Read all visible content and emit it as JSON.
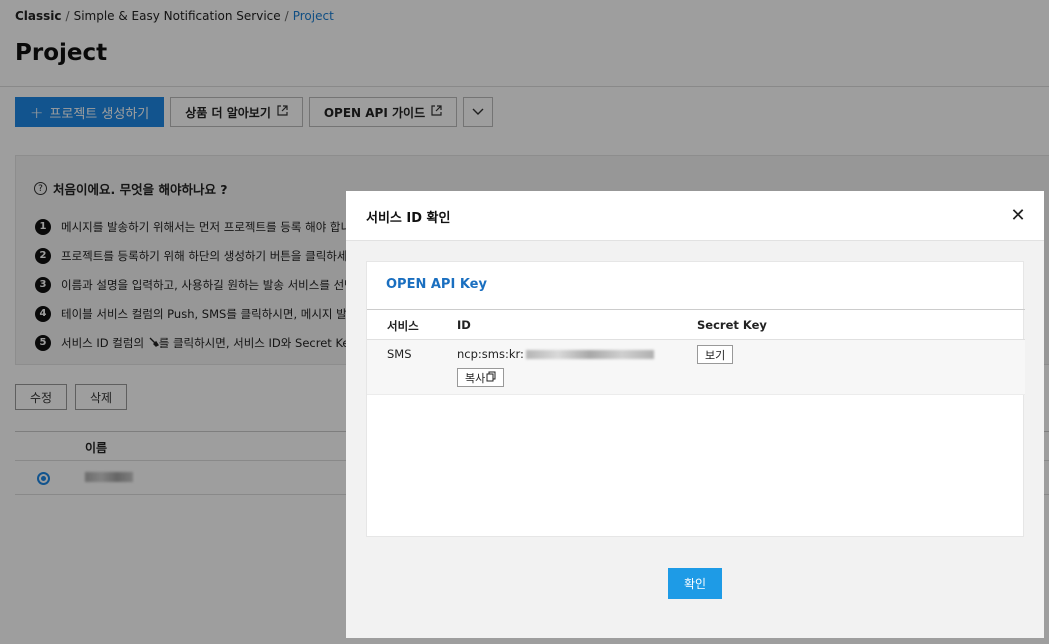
{
  "breadcrumb": {
    "root": "Classic",
    "service": "Simple & Easy Notification Service",
    "current": "Project"
  },
  "page_title": "Project",
  "toolbar": {
    "create_label": "프로젝트 생성하기",
    "product_info_label": "상품 더 알아보기",
    "api_guide_label": "OPEN API 가이드"
  },
  "guide": {
    "title": "처음이에요. 무엇을 해야하나요 ?",
    "steps": [
      {
        "num": "1",
        "text": "메시지를 발송하기 위해서는 먼저 프로젝트를 등록 해야 합니다"
      },
      {
        "num": "2",
        "text": "프로젝트를 등록하기 위해 하단의 생성하기 버튼을 클릭하세요"
      },
      {
        "num": "3",
        "text": "이름과 설명을 입력하고, 사용하길 원하는 발송 서비스를 선택하"
      },
      {
        "num": "4",
        "text": "테이블 서비스 컬럼의 Push, SMS를 클릭하시면, 메시지 발송"
      },
      {
        "num": "5",
        "text": "서비스 ID 컬럼의 ",
        "text_after": "를 클릭하시면, 서비스 ID와 Secret Key를"
      }
    ]
  },
  "actions": {
    "edit_label": "수정",
    "delete_label": "삭제"
  },
  "table": {
    "name_header": "이름"
  },
  "modal": {
    "title": "서비스 ID 확인",
    "card_title": "OPEN API Key",
    "headers": {
      "service": "서비스",
      "id": "ID",
      "secret": "Secret Key"
    },
    "row": {
      "service": "SMS",
      "id_prefix": "ncp:sms:kr:",
      "copy_label": "복사",
      "view_label": "보기"
    },
    "confirm_label": "확인"
  },
  "colors": {
    "accent": "#1e88e5",
    "link": "#1a6fc0",
    "confirm": "#1e9be6"
  }
}
